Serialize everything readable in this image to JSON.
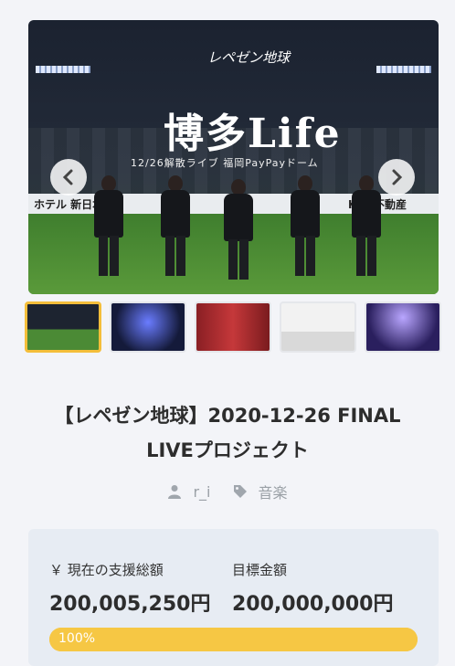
{
  "hero": {
    "logo_text": "レペゼン地球",
    "art_title": "博多Life",
    "art_subtitle": "12/26解散ライブ 福岡PayPayドーム",
    "banner_left": "ホテル 新日本",
    "banner_right": "KIN 不動産"
  },
  "thumbnails": [
    "stage-overview",
    "light-show",
    "santa-costumes",
    "dance-pose",
    "crowd-lights"
  ],
  "project": {
    "title_line1": "【レペゼン地球】2020-12-26 FINAL",
    "title_line2": "LIVEプロジェクト",
    "author": "r_i",
    "category": "音楽"
  },
  "funding": {
    "current_label": "￥ 現在の支援総額",
    "current_value": "200,005,250円",
    "goal_label": "目標金額",
    "goal_value": "200,000,000円",
    "progress_text": "100%",
    "progress_percent": 100
  },
  "colors": {
    "accent": "#f6c744",
    "panel": "#e7ecf3"
  }
}
